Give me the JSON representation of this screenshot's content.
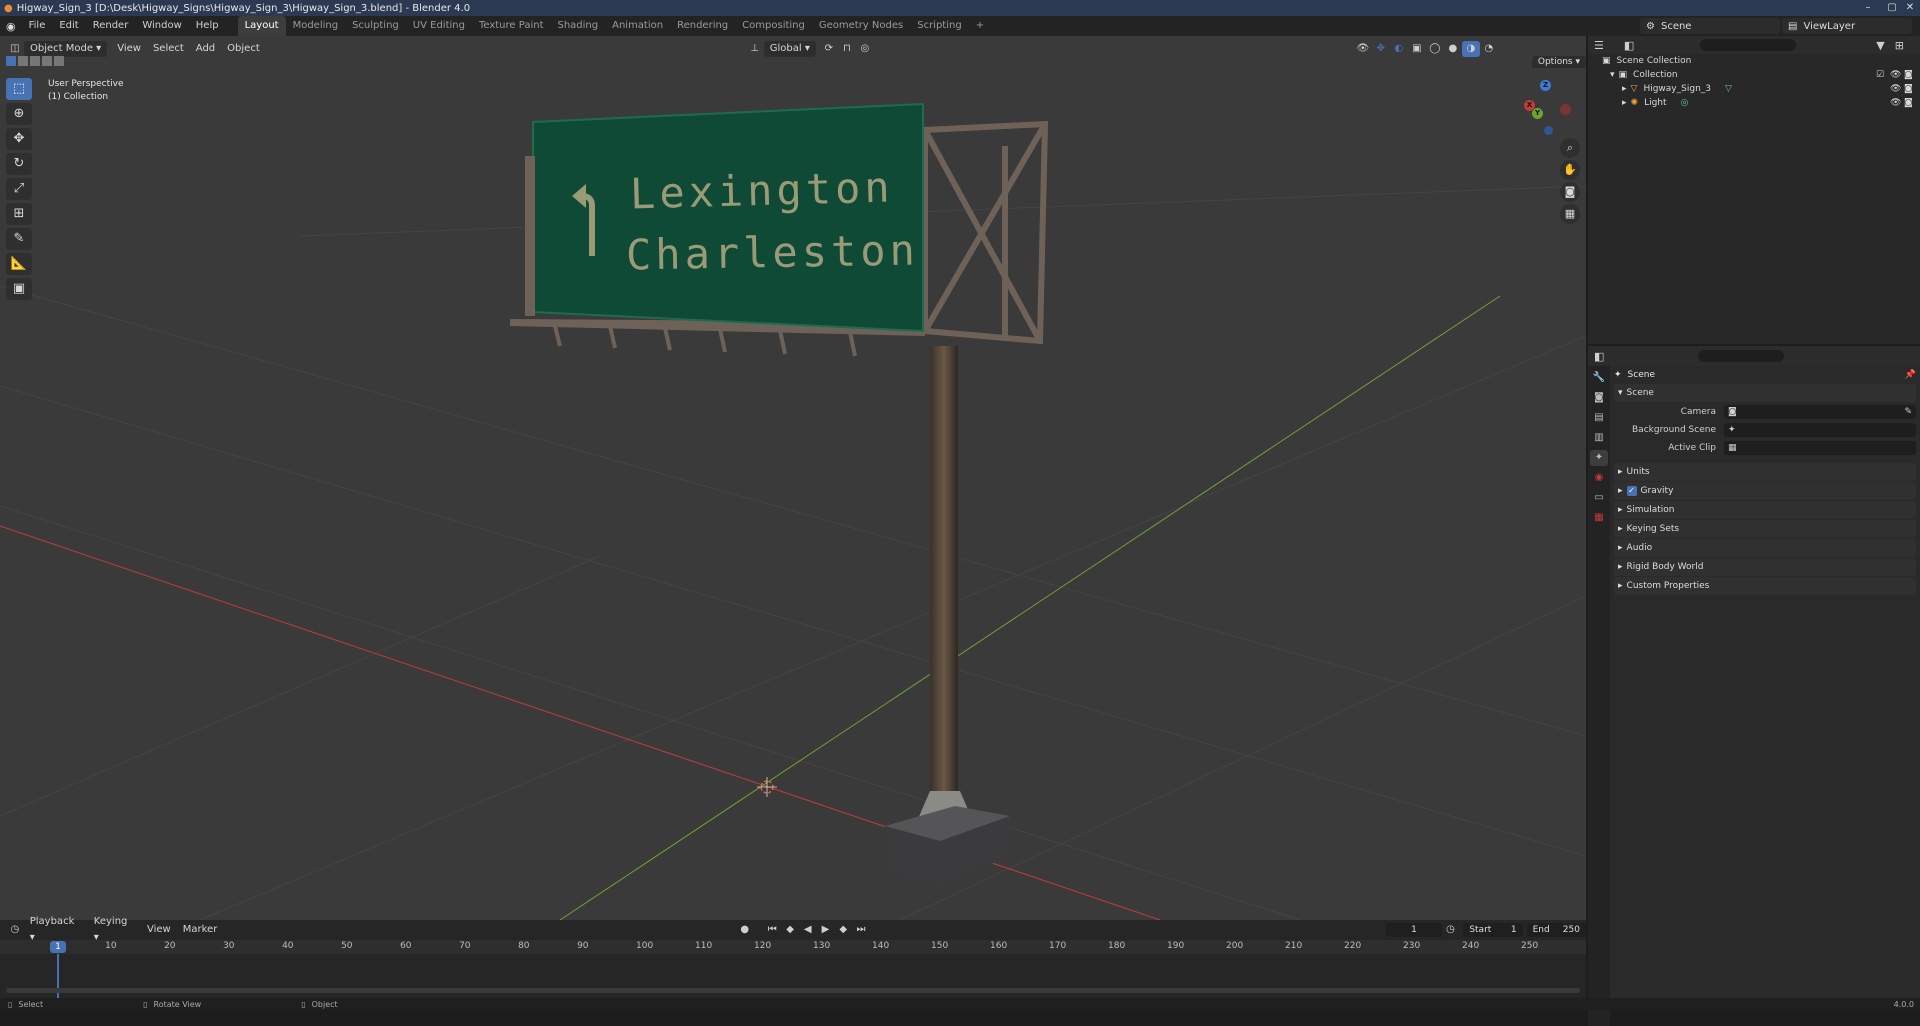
{
  "window": {
    "title": "Higway_Sign_3 [D:\\Desk\\Higway_Signs\\Higway_Sign_3\\Higway_Sign_3.blend] - Blender 4.0"
  },
  "menu": {
    "items": [
      "File",
      "Edit",
      "Render",
      "Window",
      "Help"
    ]
  },
  "workspaces": {
    "tabs": [
      "Layout",
      "Modeling",
      "Sculpting",
      "UV Editing",
      "Texture Paint",
      "Shading",
      "Animation",
      "Rendering",
      "Compositing",
      "Geometry Nodes",
      "Scripting"
    ],
    "add": "+"
  },
  "scene_selector": {
    "scene": "Scene",
    "view_layer": "ViewLayer"
  },
  "viewport": {
    "mode": "Object Mode",
    "menus": [
      "View",
      "Select",
      "Add",
      "Object"
    ],
    "transform_orientation": "Global",
    "options": "Options",
    "info_line1": "User Perspective",
    "info_line2": "(1) Collection",
    "sign_text_line1": "Lexington",
    "sign_text_line2": "Charleston",
    "gizmo": {
      "x": "X",
      "y": "Y",
      "z": "Z"
    }
  },
  "outliner": {
    "root": "Scene Collection",
    "collection": "Collection",
    "objects": [
      "Higway_Sign_3",
      "Light"
    ]
  },
  "properties": {
    "title": "Scene",
    "panel": "Scene",
    "fields": [
      {
        "label": "Camera",
        "value": ""
      },
      {
        "label": "Background Scene",
        "value": ""
      },
      {
        "label": "Active Clip",
        "value": ""
      }
    ],
    "sections": [
      "Units",
      "Gravity",
      "Simulation",
      "Keying Sets",
      "Audio",
      "Rigid Body World",
      "Custom Properties"
    ],
    "gravity_checked": true
  },
  "timeline": {
    "menus": [
      "Playback",
      "Keying",
      "View",
      "Marker"
    ],
    "current_frame": "1",
    "start_label": "Start",
    "start": "1",
    "end_label": "End",
    "end": "250",
    "ruler": [
      "1",
      "10",
      "20",
      "30",
      "40",
      "50",
      "60",
      "70",
      "80",
      "90",
      "100",
      "110",
      "120",
      "130",
      "140",
      "150",
      "160",
      "170",
      "180",
      "190",
      "200",
      "210",
      "220",
      "230",
      "240",
      "250"
    ]
  },
  "statusbar": {
    "select": "Select",
    "rotate": "Rotate View",
    "object": "Object",
    "version": "4.0.0"
  },
  "colors": {
    "accent": "#4772b3",
    "sign_green": "#0f4a36",
    "x_axis": "#c23b3b",
    "y_axis": "#6fa32e",
    "z_axis": "#3c7bd6"
  }
}
